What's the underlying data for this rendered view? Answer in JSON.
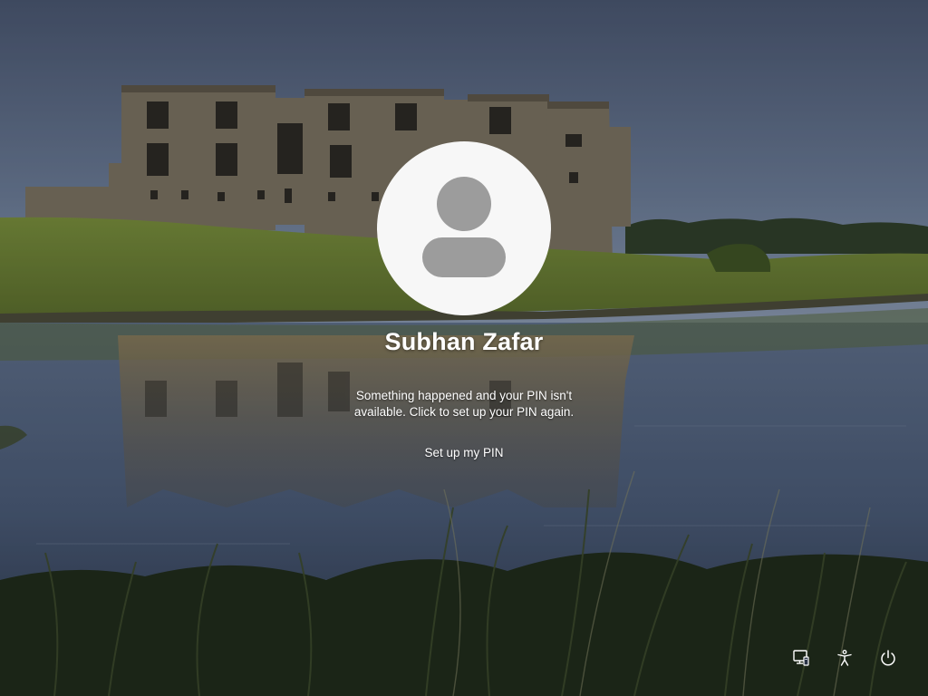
{
  "user": {
    "name": "Subhan Zafar"
  },
  "message": {
    "line1": "Something happened and your PIN isn't",
    "line2": "available. Click to set up your PIN again."
  },
  "actions": {
    "setup_pin_label": "Set up my PIN"
  },
  "system_buttons": [
    {
      "icon": "network-icon"
    },
    {
      "icon": "accessibility-icon"
    },
    {
      "icon": "power-icon"
    }
  ],
  "colors": {
    "text": "#ffffff",
    "avatar_bg": "#f7f7f7",
    "avatar_figure": "#9c9c9c"
  }
}
